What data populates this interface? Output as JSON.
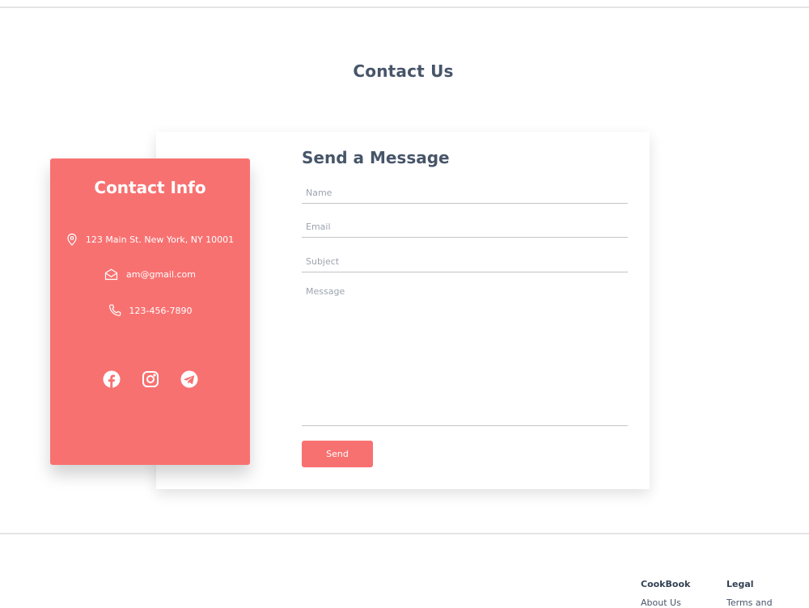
{
  "page": {
    "title": "Contact Us"
  },
  "contact_info": {
    "title": "Contact Info",
    "address": "123 Main St. New York, NY 10001",
    "email": "am@gmail.com",
    "phone": "123-456-7890",
    "social_icons": [
      "facebook-icon",
      "instagram-icon",
      "telegram-icon"
    ]
  },
  "form": {
    "title": "Send a Message",
    "name_placeholder": "Name",
    "email_placeholder": "Email",
    "subject_placeholder": "Subject",
    "message_placeholder": "Message",
    "send_label": "Send"
  },
  "footer": {
    "columns": [
      {
        "heading": "CookBook",
        "links": [
          "About Us"
        ]
      },
      {
        "heading": "Legal",
        "links": [
          "Terms and"
        ]
      }
    ]
  },
  "colors": {
    "accent": "#f87171",
    "heading": "#475569"
  }
}
